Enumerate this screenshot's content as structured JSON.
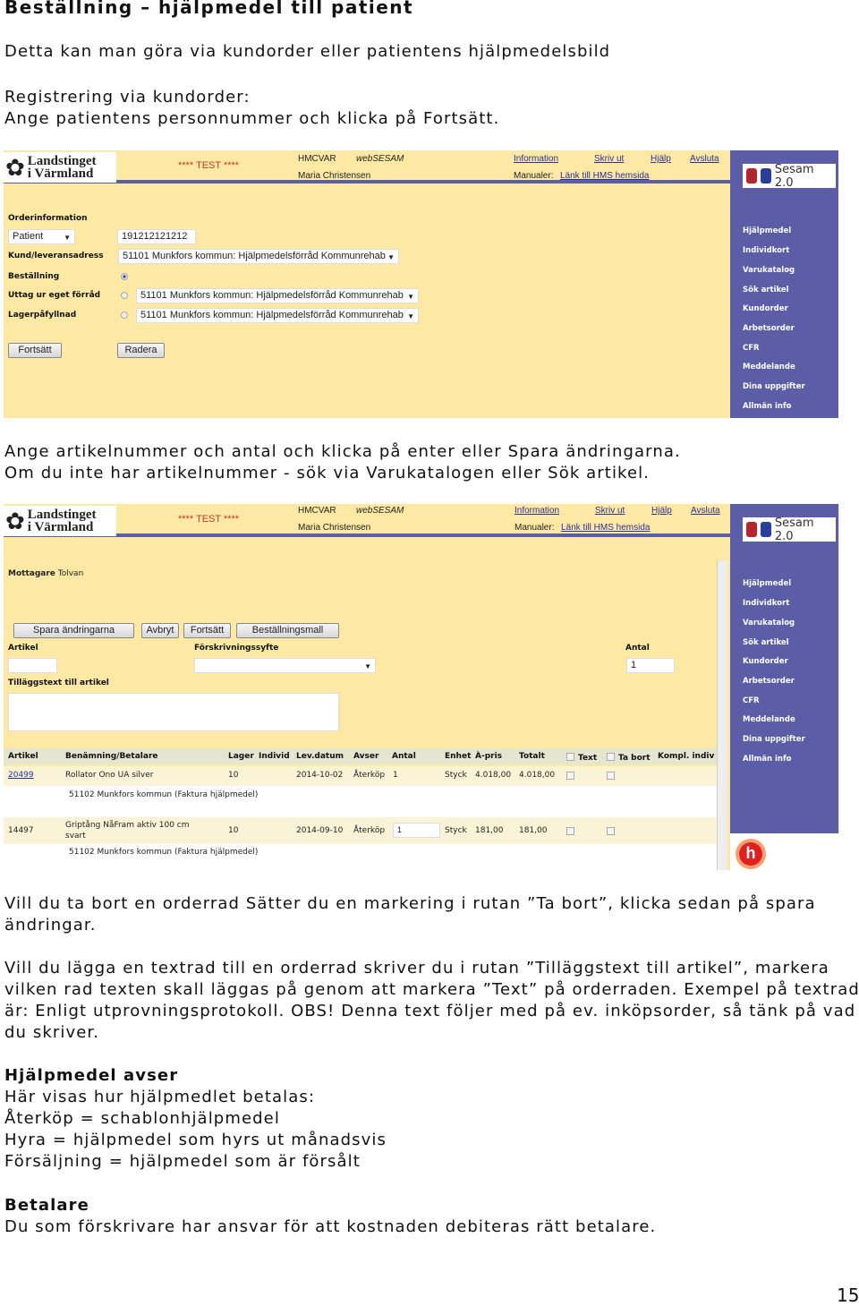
{
  "doc": {
    "heading": "Beställning – hjälpmedel till patient",
    "p1": "Detta kan man göra via kundorder eller patientens hjälpmedelsbild",
    "p2a": "Registrering via kundorder:",
    "p2b": "Ange patientens personnummer och klicka på Fortsätt.",
    "p3a": "Ange artikelnummer och antal och klicka på enter eller Spara ändringarna.",
    "p3b": "Om du inte har artikelnummer - sök via Varukatalogen eller Sök artikel.",
    "p4a": "Vill du ta bort en orderrad Sätter du en markering i rutan ”Ta bort”, klicka sedan på spara",
    "p4b": "ändringar.",
    "p5a": "Vill du lägga en textrad till en orderrad skriver du i rutan ”Tilläggstext till artikel”, markera",
    "p5b": "vilken rad texten skall läggas på genom att markera ”Text” på orderraden. Exempel på textrad",
    "p5c": "är: Enligt utprovningsprotokoll. OBS! Denna text följer med på ev. inköpsorder, så tänk på vad",
    "p5d": "du skriver.",
    "h2": "Hjälpmedel avser",
    "p6a": "Här visas hur hjälpmedlet betalas:",
    "p6b": "Återköp = schablonhjälpmedel",
    "p6c": "Hyra = hjälpmedel som hyrs ut månadsvis",
    "p6d": "Försäljning = hjälpmedel som är försålt",
    "h3": "Betalare",
    "p7": "Du som förskrivare har ansvar för att kostnaden debiteras rätt betalare.",
    "page_number": "15"
  },
  "app": {
    "logo_line1": "Landstinget",
    "logo_line2": "i Värmland",
    "test": "**** TEST ****",
    "user_code": "HMCVAR",
    "app_name": "webSESAM",
    "user_name": "Maria Christensen",
    "links": [
      "Information",
      "Skriv ut",
      "Hjälp",
      "Avsluta"
    ],
    "manualer_label": "Manualer:",
    "manualer_link": "Länk till HMS hemsida",
    "sesam": "Sesam 2.0",
    "sidebar": [
      "Hjälpmedel",
      "Individkort",
      "Varukatalog",
      "Sök artikel",
      "Kundorder",
      "Arbetsorder",
      "CFR",
      "Meddelande",
      "Dina uppgifter",
      "Allmän info"
    ],
    "colors": {
      "background": "#fde9a3",
      "sidebar": "#5b5ea6",
      "test": "#c0392b"
    }
  },
  "shot1": {
    "section": "Orderinformation",
    "type_select": "Patient",
    "personnummer": "191212121212",
    "kund_label": "Kund/leveransadress",
    "kund_value": "51101 Munkfors kommun: Hjälpmedelsförråd Kommunrehab",
    "bestallning": "Beställning",
    "uttag": "Uttag ur eget förråd",
    "uttag_value": "51101 Munkfors kommun: Hjälpmedelsförråd Kommunrehab",
    "lager": "Lagerpåfyllnad",
    "lager_value": "51101 Munkfors kommun: Hjälpmedelsförråd Kommunrehab",
    "fortsatt": "Fortsätt",
    "radera": "Radera"
  },
  "shot2": {
    "mottagare_label": "Mottagare",
    "mottagare_value": "Tolvan",
    "buttons": [
      "Spara ändringarna",
      "Avbryt",
      "Fortsätt",
      "Beställningsmall"
    ],
    "artikel_label": "Artikel",
    "syfte_label": "Förskrivningssyfte",
    "antal_label": "Antal",
    "antal_value": "1",
    "tillagg_label": "Tilläggstext till artikel",
    "columns": [
      "Artikel",
      "Benämning/Betalare",
      "Lager",
      "Individ",
      "Lev.datum",
      "Avser",
      "Antal",
      "Enhet",
      "À-pris",
      "Totalt",
      "Text",
      "Ta bort",
      "Kompl. indiv"
    ],
    "rows": [
      {
        "artikel": "20499",
        "benamning": "Rollator Ono UA silver",
        "benamning2": "",
        "lager": "10",
        "levdatum": "2014-10-02",
        "avser": "Återköp",
        "antal": "1",
        "enhet": "Styck",
        "apris": "4.018,00",
        "totalt": "4.018,00",
        "betalare": "51102 Munkfors kommun (Faktura hjälpmedel)"
      },
      {
        "artikel": "14497",
        "benamning": "Griptång NåFram aktiv 100 cm",
        "benamning2": "svart",
        "lager": "10",
        "levdatum": "2014-09-10",
        "avser": "Återköp",
        "antal": "1",
        "enhet": "Styck",
        "apris": "181,00",
        "totalt": "181,00",
        "betalare": "51102 Munkfors kommun (Faktura hjälpmedel)"
      }
    ]
  }
}
